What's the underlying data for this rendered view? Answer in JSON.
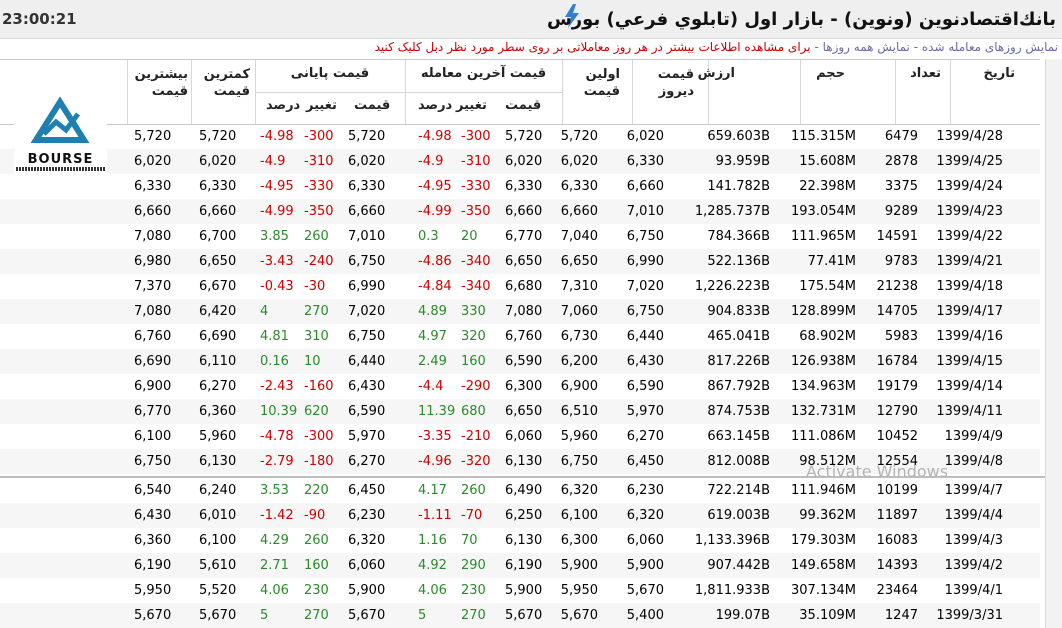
{
  "header": {
    "time": "23:00:21",
    "title": "بانك‌اقتصادنوین (ونوین) - بازار اول (تابلوي فرعي) بورس"
  },
  "links": {
    "traded_days": "نمایش روزهای معامله شده",
    "all_days": "نمایش همه روزها",
    "hint": "برای مشاهده اطلاعات بیشتر در هر روز معاملاتی بر روی سطر مورد نظر دبل کلیک کنید"
  },
  "table": {
    "headers": {
      "date": "تاریخ",
      "count": "تعداد",
      "volume": "حجم",
      "value": "ارزش",
      "yesterday_price": "قیمت دیروز",
      "first_price": "اولین قیمت",
      "last_trade_group": "قیمت آخرین معامله",
      "closing_group": "قیمت پایانی",
      "price": "قیمت",
      "change": "تغییر",
      "percent": "درصد",
      "min_price": "کمترین قیمت",
      "max_price": "بیشترین قیمت"
    },
    "rows": [
      {
        "date": "1399/4/28",
        "count": "6479",
        "volume": "115.315M",
        "value": "659.603B",
        "prev": "6,020",
        "first": "5,720",
        "last_price": "5,720",
        "last_change": "-300",
        "last_pct": "-4.98",
        "close_price": "5,720",
        "close_change": "-300",
        "close_pct": "-4.98",
        "min": "5,720",
        "max": "5,720"
      },
      {
        "date": "1399/4/25",
        "count": "2878",
        "volume": "15.608M",
        "value": "93.959B",
        "prev": "6,330",
        "first": "6,020",
        "last_price": "6,020",
        "last_change": "-310",
        "last_pct": "-4.9",
        "close_price": "6,020",
        "close_change": "-310",
        "close_pct": "-4.9",
        "min": "6,020",
        "max": "6,020"
      },
      {
        "date": "1399/4/24",
        "count": "3375",
        "volume": "22.398M",
        "value": "141.782B",
        "prev": "6,660",
        "first": "6,330",
        "last_price": "6,330",
        "last_change": "-330",
        "last_pct": "-4.95",
        "close_price": "6,330",
        "close_change": "-330",
        "close_pct": "-4.95",
        "min": "6,330",
        "max": "6,330"
      },
      {
        "date": "1399/4/23",
        "count": "9289",
        "volume": "193.054M",
        "value": "1,285.737B",
        "prev": "7,010",
        "first": "6,660",
        "last_price": "6,660",
        "last_change": "-350",
        "last_pct": "-4.99",
        "close_price": "6,660",
        "close_change": "-350",
        "close_pct": "-4.99",
        "min": "6,660",
        "max": "6,660"
      },
      {
        "date": "1399/4/22",
        "count": "14591",
        "volume": "111.965M",
        "value": "784.366B",
        "prev": "6,750",
        "first": "7,040",
        "last_price": "6,770",
        "last_change": "20",
        "last_pct": "0.3",
        "close_price": "7,010",
        "close_change": "260",
        "close_pct": "3.85",
        "min": "6,700",
        "max": "7,080"
      },
      {
        "date": "1399/4/21",
        "count": "9783",
        "volume": "77.41M",
        "value": "522.136B",
        "prev": "6,990",
        "first": "6,650",
        "last_price": "6,650",
        "last_change": "-340",
        "last_pct": "-4.86",
        "close_price": "6,750",
        "close_change": "-240",
        "close_pct": "-3.43",
        "min": "6,650",
        "max": "6,980"
      },
      {
        "date": "1399/4/18",
        "count": "21238",
        "volume": "175.54M",
        "value": "1,226.223B",
        "prev": "7,020",
        "first": "7,310",
        "last_price": "6,680",
        "last_change": "-340",
        "last_pct": "-4.84",
        "close_price": "6,990",
        "close_change": "-30",
        "close_pct": "-0.43",
        "min": "6,670",
        "max": "7,370"
      },
      {
        "date": "1399/4/17",
        "count": "14705",
        "volume": "128.899M",
        "value": "904.833B",
        "prev": "6,750",
        "first": "7,060",
        "last_price": "7,080",
        "last_change": "330",
        "last_pct": "4.89",
        "close_price": "7,020",
        "close_change": "270",
        "close_pct": "4",
        "min": "6,420",
        "max": "7,080"
      },
      {
        "date": "1399/4/16",
        "count": "5983",
        "volume": "68.902M",
        "value": "465.041B",
        "prev": "6,440",
        "first": "6,730",
        "last_price": "6,760",
        "last_change": "320",
        "last_pct": "4.97",
        "close_price": "6,750",
        "close_change": "310",
        "close_pct": "4.81",
        "min": "6,690",
        "max": "6,760"
      },
      {
        "date": "1399/4/15",
        "count": "16784",
        "volume": "126.938M",
        "value": "817.226B",
        "prev": "6,430",
        "first": "6,200",
        "last_price": "6,590",
        "last_change": "160",
        "last_pct": "2.49",
        "close_price": "6,440",
        "close_change": "10",
        "close_pct": "0.16",
        "min": "6,110",
        "max": "6,690"
      },
      {
        "date": "1399/4/14",
        "count": "19179",
        "volume": "134.963M",
        "value": "867.792B",
        "prev": "6,590",
        "first": "6,900",
        "last_price": "6,300",
        "last_change": "-290",
        "last_pct": "-4.4",
        "close_price": "6,430",
        "close_change": "-160",
        "close_pct": "-2.43",
        "min": "6,270",
        "max": "6,900"
      },
      {
        "date": "1399/4/11",
        "count": "12790",
        "volume": "132.731M",
        "value": "874.753B",
        "prev": "5,970",
        "first": "6,510",
        "last_price": "6,650",
        "last_change": "680",
        "last_pct": "11.39",
        "close_price": "6,590",
        "close_change": "620",
        "close_pct": "10.39",
        "min": "6,360",
        "max": "6,770"
      },
      {
        "date": "1399/4/9",
        "count": "10452",
        "volume": "111.086M",
        "value": "663.145B",
        "prev": "6,270",
        "first": "5,960",
        "last_price": "6,060",
        "last_change": "-210",
        "last_pct": "-3.35",
        "close_price": "5,970",
        "close_change": "-300",
        "close_pct": "-4.78",
        "min": "5,960",
        "max": "6,100"
      },
      {
        "date": "1399/4/8",
        "count": "12554",
        "volume": "98.512M",
        "value": "812.008B",
        "prev": "6,450",
        "first": "6,750",
        "last_price": "6,130",
        "last_change": "-320",
        "last_pct": "-4.96",
        "close_price": "6,270",
        "close_change": "-180",
        "close_pct": "-2.79",
        "min": "6,130",
        "max": "6,750"
      },
      {
        "date": "1399/4/7",
        "count": "10199",
        "volume": "111.946M",
        "value": "722.214B",
        "prev": "6,230",
        "first": "6,320",
        "last_price": "6,490",
        "last_change": "260",
        "last_pct": "4.17",
        "close_price": "6,450",
        "close_change": "220",
        "close_pct": "3.53",
        "min": "6,240",
        "max": "6,540"
      },
      {
        "date": "1399/4/4",
        "count": "11897",
        "volume": "99.362M",
        "value": "619.003B",
        "prev": "6,320",
        "first": "6,100",
        "last_price": "6,250",
        "last_change": "-70",
        "last_pct": "-1.11",
        "close_price": "6,230",
        "close_change": "-90",
        "close_pct": "-1.42",
        "min": "6,010",
        "max": "6,430"
      },
      {
        "date": "1399/4/3",
        "count": "16083",
        "volume": "179.303M",
        "value": "1,133.396B",
        "prev": "6,060",
        "first": "6,300",
        "last_price": "6,130",
        "last_change": "70",
        "last_pct": "1.16",
        "close_price": "6,320",
        "close_change": "260",
        "close_pct": "4.29",
        "min": "6,100",
        "max": "6,360"
      },
      {
        "date": "1399/4/2",
        "count": "14393",
        "volume": "149.658M",
        "value": "907.442B",
        "prev": "5,900",
        "first": "5,900",
        "last_price": "6,190",
        "last_change": "290",
        "last_pct": "4.92",
        "close_price": "6,060",
        "close_change": "160",
        "close_pct": "2.71",
        "min": "5,610",
        "max": "6,190"
      },
      {
        "date": "1399/4/1",
        "count": "23464",
        "volume": "307.134M",
        "value": "1,811.933B",
        "prev": "5,670",
        "first": "5,950",
        "last_price": "5,900",
        "last_change": "230",
        "last_pct": "4.06",
        "close_price": "5,900",
        "close_change": "230",
        "close_pct": "4.06",
        "min": "5,520",
        "max": "5,950"
      },
      {
        "date": "1399/3/31",
        "count": "1247",
        "volume": "35.109M",
        "value": "199.07B",
        "prev": "5,400",
        "first": "5,670",
        "last_price": "5,670",
        "last_change": "270",
        "last_pct": "5",
        "close_price": "5,670",
        "close_change": "270",
        "close_pct": "5",
        "min": "5,670",
        "max": "5,670"
      }
    ]
  },
  "logo": {
    "text": "BOURSE"
  },
  "watermark": "Activate Windows",
  "colors": {
    "negative": "#cc0000",
    "positive": "#2a8a2a",
    "link": "#6a6aa8"
  }
}
